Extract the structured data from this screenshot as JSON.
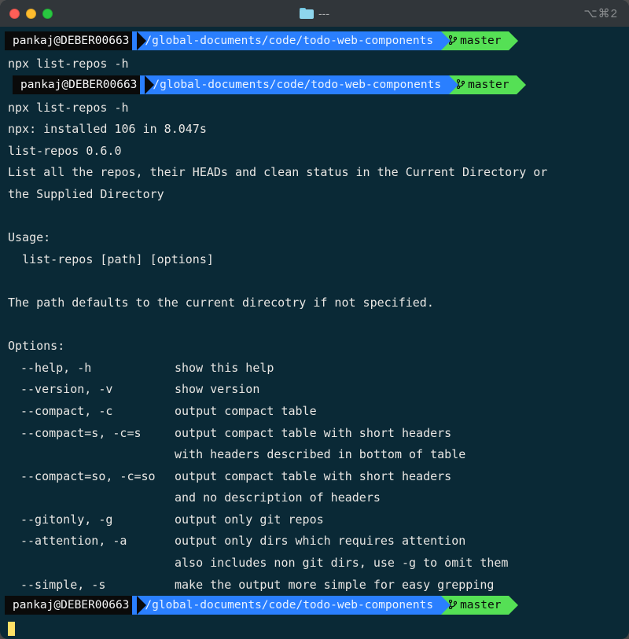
{
  "titlebar": {
    "title": "---",
    "modifier": "⌥⌘2"
  },
  "prompt": {
    "user": "pankaj@DEBER00663",
    "path": "/global-documents/code/todo-web-components",
    "branch": "master"
  },
  "cmd1": "npx list-repos -h",
  "cmd2": "npx list-repos -h",
  "lines": {
    "installed": "npx: installed 106 in 8.047s",
    "version": "list-repos 0.6.0",
    "desc1": "List all the repos, their HEADs and clean status in the Current Directory or",
    "desc2": "the Supplied Directory",
    "usage_h": "Usage:",
    "usage": "  list-repos [path] [options]",
    "pathdef": "The path defaults to the current direcotry if not specified.",
    "options_h": "Options:"
  },
  "opts": [
    {
      "flag": "--help, -h",
      "desc": "show this help"
    },
    {
      "flag": "--version, -v",
      "desc": "show version"
    },
    {
      "flag": "--compact, -c",
      "desc": "output compact table"
    },
    {
      "flag": "--compact=s, -c=s",
      "desc": "output compact table with short headers"
    },
    {
      "flag": "",
      "desc": "with headers described in bottom of table"
    },
    {
      "flag": "--compact=so, -c=so",
      "desc": "output compact table with short headers"
    },
    {
      "flag": "",
      "desc": "and no description of headers"
    },
    {
      "flag": "--gitonly, -g",
      "desc": "output only git repos"
    },
    {
      "flag": "--attention, -a",
      "desc": "output only dirs which requires attention"
    },
    {
      "flag": "",
      "desc": "also includes non git dirs, use -g to omit them"
    },
    {
      "flag": "--simple, -s",
      "desc": "make the output more simple for easy grepping"
    }
  ]
}
